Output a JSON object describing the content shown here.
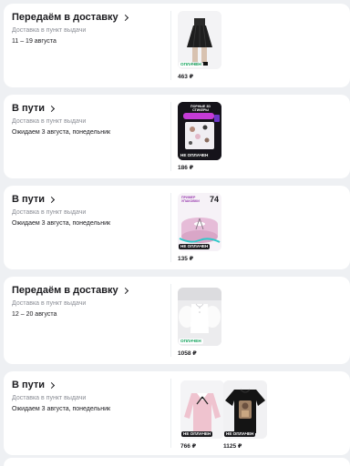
{
  "orders": [
    {
      "status": "Передаём в доставку",
      "method": "Доставка в пункт выдачи",
      "eta": "11 – 19 августа",
      "items": [
        {
          "badge": "ОПЛАЧЕН",
          "paid": true,
          "price": "463 ₽",
          "image": "black-pleated-skirt"
        }
      ]
    },
    {
      "status": "В пути",
      "method": "Доставка в пункт выдачи",
      "eta": "Ожидаем 3 августа, понедельник",
      "items": [
        {
          "badge": "НЕ ОПЛАЧЕН",
          "paid": false,
          "price": "186 ₽",
          "image": "3d-stickers-pack",
          "overlay_title": "ПОРНЫЕ 3D СТИКЕРЫ"
        }
      ]
    },
    {
      "status": "В пути",
      "method": "Доставка в пункт выдачи",
      "eta": "Ожидаем 3 августа, понедельник",
      "items": [
        {
          "badge": "НЕ ОПЛАЧЕН",
          "paid": false,
          "price": "135 ₽",
          "image": "ribbon-spool",
          "overlay_title": "ПРИМЕР УПАКОВКИ",
          "brand_mark": "74"
        }
      ]
    },
    {
      "status": "Передаём в доставку",
      "method": "Доставка в пункт выдачи",
      "eta": "12 – 20 августа",
      "items": [
        {
          "badge": "ОПЛАЧЕН",
          "paid": true,
          "price": "1058 ₽",
          "image": "white-puff-blouse"
        }
      ]
    },
    {
      "status": "В пути",
      "method": "Доставка в пункт выдачи",
      "eta": "Ожидаем 3 августа, понедельник",
      "items": [
        {
          "badge": "НЕ ОПЛАЧЕН",
          "paid": false,
          "price": "766 ₽",
          "image": "pink-bow-sweater"
        },
        {
          "badge": "НЕ ОПЛАЧЕН",
          "paid": false,
          "price": "1125 ₽",
          "image": "black-graphic-tshirt"
        }
      ]
    }
  ],
  "colors": {
    "page_bg": "#eef0f3",
    "card_bg": "#ffffff",
    "paid_green": "#11a35a",
    "unpaid_badge_bg": "#1b1b1f",
    "muted_text": "#8a8d95"
  }
}
